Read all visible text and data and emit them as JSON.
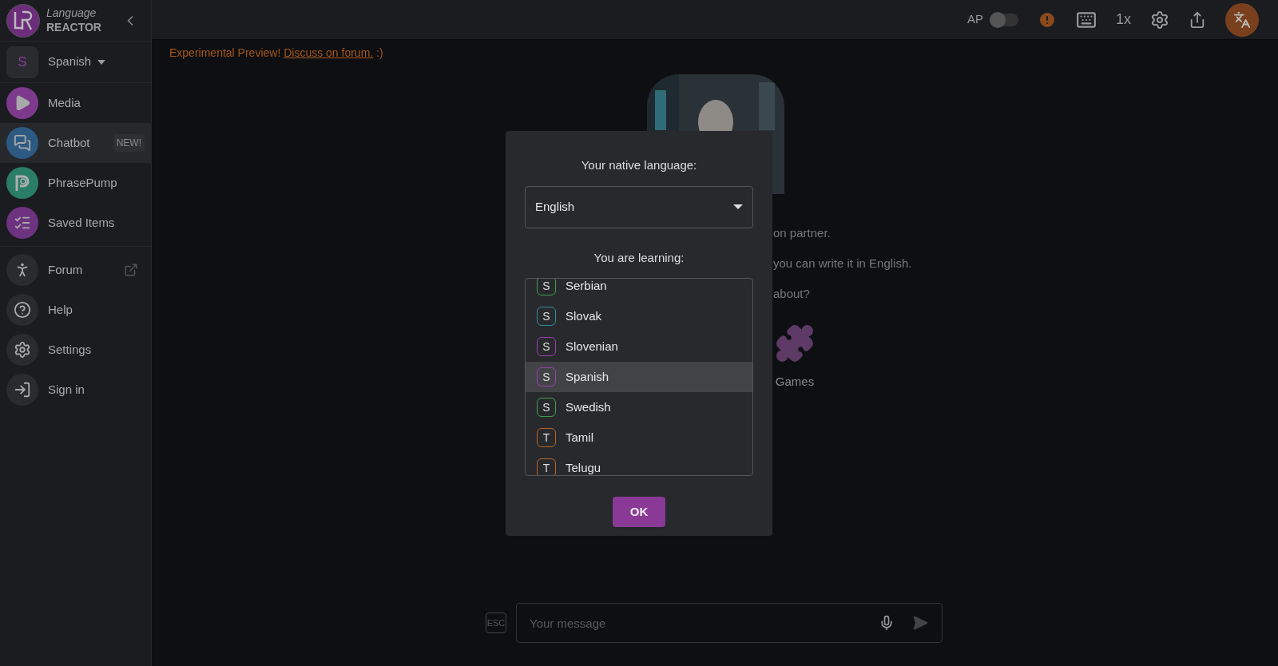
{
  "sidebar": {
    "logo": {
      "line1": "Language",
      "line2": "REACTOR"
    },
    "language": {
      "badge": "S",
      "label": "Spanish"
    },
    "items": [
      {
        "kind": "media",
        "label": "Media",
        "selected": false
      },
      {
        "kind": "chatbot",
        "label": "Chatbot",
        "selected": true,
        "badge": "NEW!"
      },
      {
        "kind": "phrasepump",
        "label": "PhrasePump",
        "selected": false
      },
      {
        "kind": "saved",
        "label": "Saved Items",
        "selected": false
      },
      {
        "kind": "forum",
        "label": "Forum",
        "selected": false,
        "external": true
      },
      {
        "kind": "help",
        "label": "Help",
        "selected": false
      },
      {
        "kind": "settings",
        "label": "Settings",
        "selected": false
      },
      {
        "kind": "signin",
        "label": "Sign in",
        "selected": false
      }
    ]
  },
  "topbar": {
    "ap_label": "AP",
    "ap_on": false,
    "speed": "1x"
  },
  "banner": {
    "text": "Experimental Preview!",
    "link": "Discuss on forum.",
    "suffix": ":)"
  },
  "background": {
    "lines": [
      "on partner.",
      "you can write it in English.",
      "about?"
    ],
    "topics": [
      {
        "label": "Games"
      }
    ]
  },
  "dialog": {
    "native_label": "Your native language:",
    "native_value": "English",
    "learning_label": "You are learning:",
    "languages": [
      {
        "letter": "S",
        "name": "Serbian",
        "color": "#3fa34d",
        "selected": false
      },
      {
        "letter": "S",
        "name": "Slovak",
        "color": "#2f8f9a",
        "selected": false
      },
      {
        "letter": "S",
        "name": "Slovenian",
        "color": "#9c3fb0",
        "selected": false
      },
      {
        "letter": "S",
        "name": "Spanish",
        "color": "#9c3fb0",
        "selected": true
      },
      {
        "letter": "S",
        "name": "Swedish",
        "color": "#3fa34d",
        "selected": false
      },
      {
        "letter": "T",
        "name": "Tamil",
        "color": "#b8652a",
        "selected": false
      },
      {
        "letter": "T",
        "name": "Telugu",
        "color": "#b8652a",
        "selected": false
      }
    ],
    "ok": "OK"
  },
  "composer": {
    "esc": "ESC",
    "placeholder": "Your message"
  }
}
